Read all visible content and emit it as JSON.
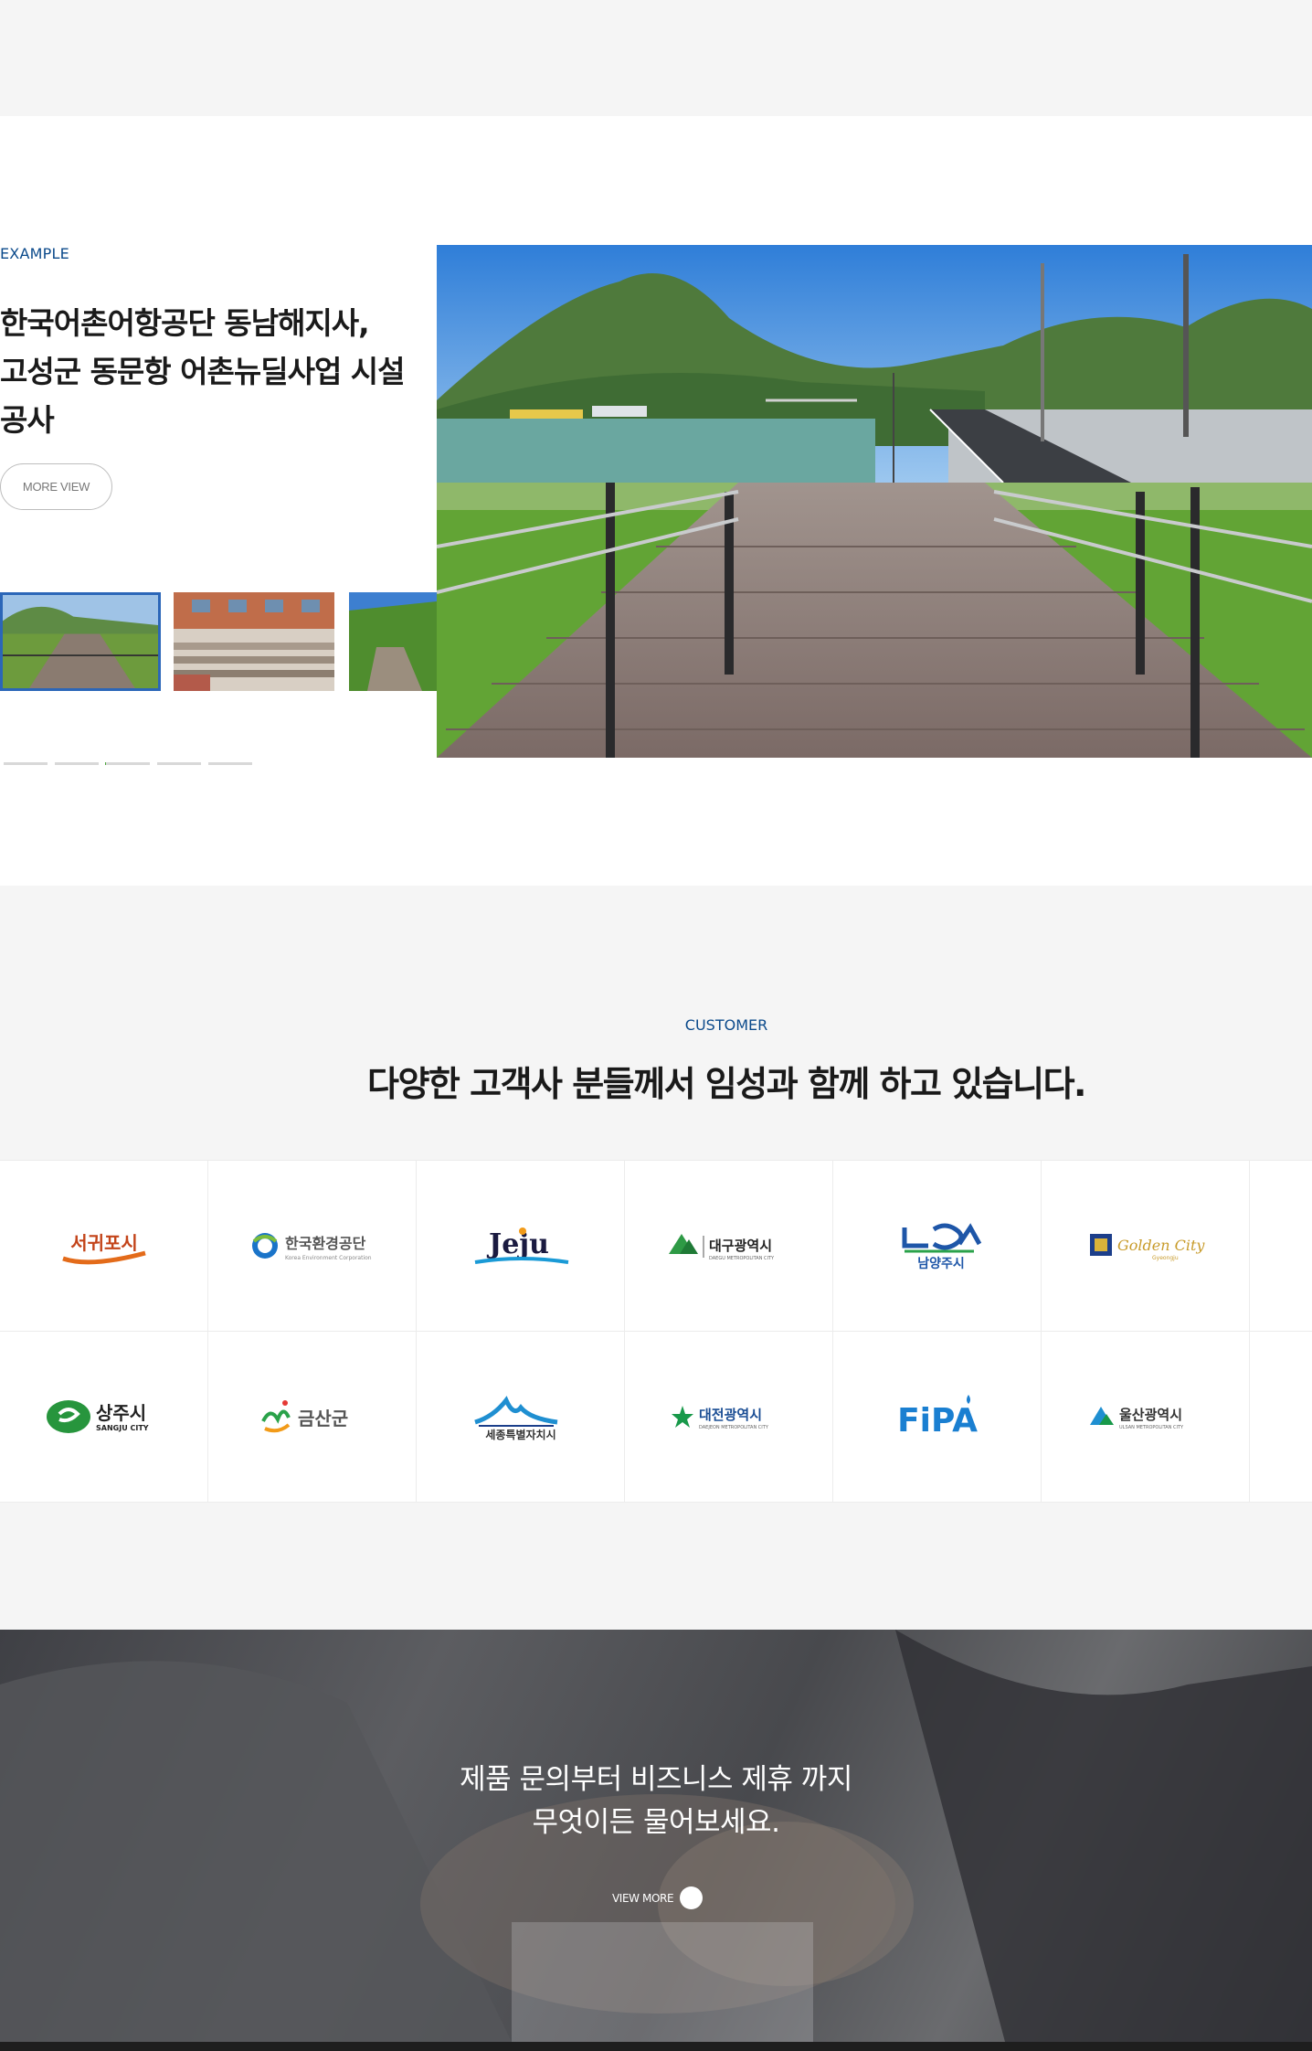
{
  "example": {
    "label": "EXAMPLE",
    "title_lines": [
      "한국어촌어항공단 동남해지사,",
      "고성군 동문항 어촌뉴딜사업 시설",
      "공사"
    ],
    "more_button": "MORE VIEW",
    "slide_count": 5,
    "active_slide": 2
  },
  "customer": {
    "label": "CUSTOMER",
    "title": "다양한 고객사 분들께서 임성과 함께 하고 있습니다.",
    "logos_row1": {
      "seogwipo": "서귀포시",
      "keco": "한국환경공단",
      "keco_sub": "Korea Environment Corporation",
      "jeju": "Jeju",
      "daegu": "대구광역시",
      "daegu_sub": "DAEGU METROPOLITAN CITY",
      "namyangju": "남양주시",
      "gyeongju": "Golden City",
      "gyeongju_sub": "Gyeongju"
    },
    "logos_row2": {
      "sangju": "상주시",
      "sangju_sub": "SANGJU CITY",
      "geumsan": "금산군",
      "sejong": "세종특별자치시",
      "daejeon": "대전광역시",
      "daejeon_sub": "DAEJEON METROPOLITAN CITY",
      "fipa": "FiPA",
      "ulsan": "울산광역시",
      "ulsan_sub": "ULSAN METROPOLITAN CITY"
    }
  },
  "contact": {
    "line1": "제품 문의부터 비즈니스 제휴 까지",
    "line2": "무엇이든 물어보세요.",
    "view_more": "VIEW MORE"
  }
}
